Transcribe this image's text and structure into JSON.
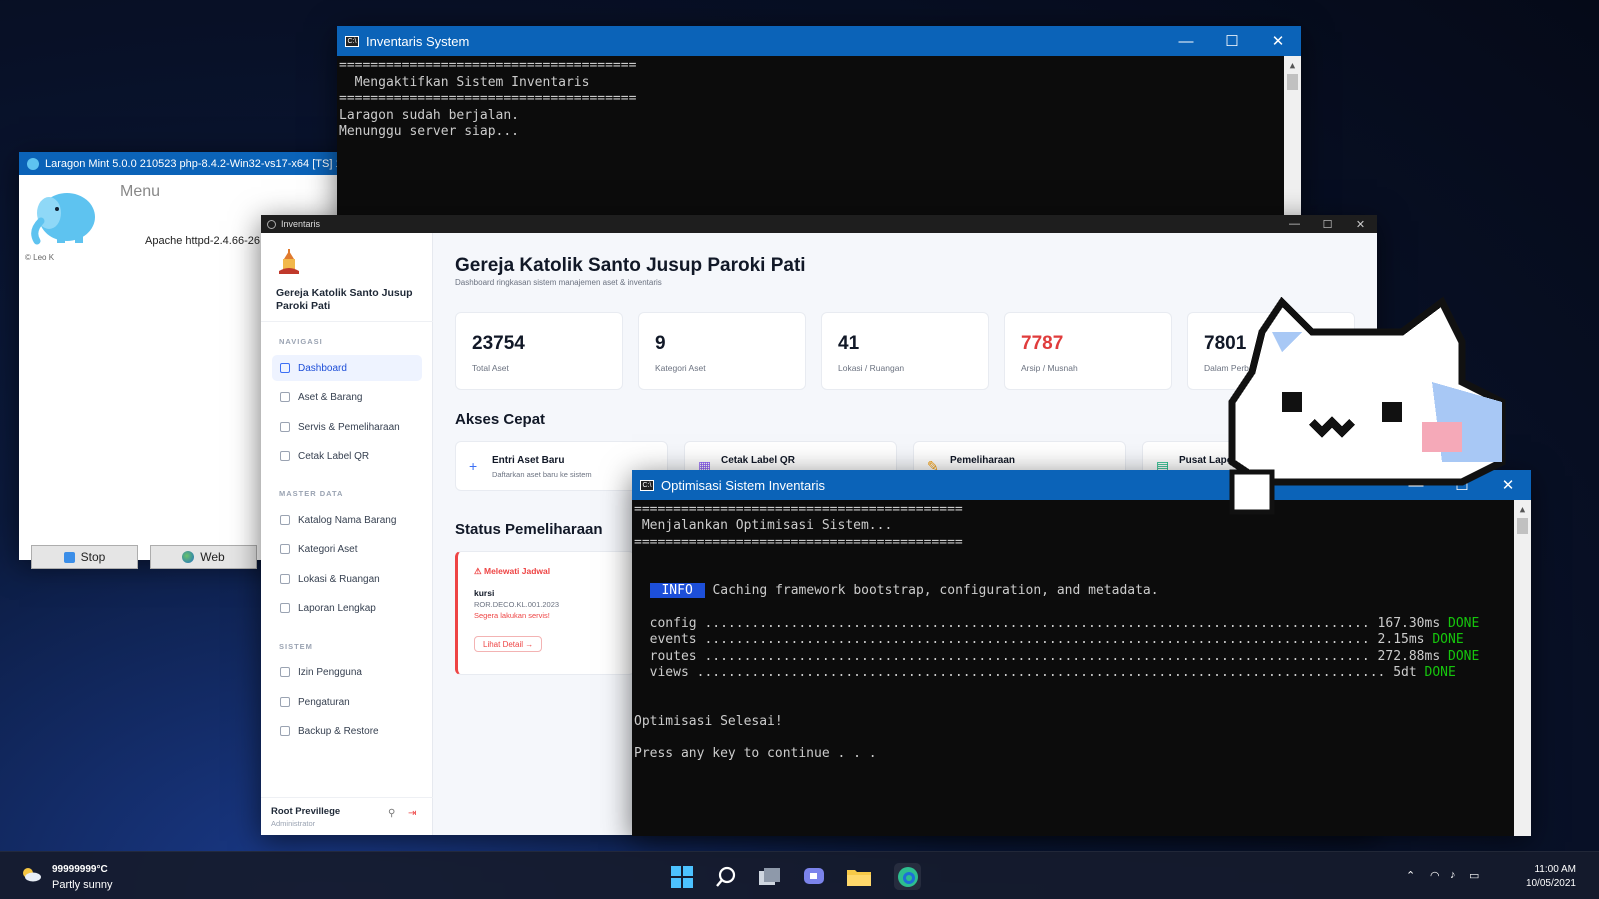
{
  "colors": {
    "accent": "#0b63b8",
    "done": "#16c60c",
    "danger": "#e03c3c",
    "primary": "#1d4ed8"
  },
  "laragon": {
    "title": "Laragon Mint 5.0.0 210523 php-8.4.2-Win32-vs17-x64 [TS]  192.168.112.1",
    "menu_label": "Menu",
    "version_label": "© Leo K",
    "apache_label": "Apache httpd-2.4.66-26",
    "stop_label": "Stop",
    "web_label": "Web",
    "icons": [
      "h",
      "?",
      "gear-icon"
    ]
  },
  "invsys": {
    "title": "Inventaris System",
    "lines": [
      "======================================",
      "  Mengaktifkan Sistem Inventaris",
      "======================================",
      "Laragon sudah berjalan.",
      "Menunggu server siap..."
    ]
  },
  "app": {
    "title": "Inventaris",
    "sidebar": {
      "church_name": "Gereja Katolik Santo Jusup Paroki Pati",
      "section_nav": "NAVIGASI",
      "section_master": "MASTER DATA",
      "section_system": "SISTEM",
      "nav": [
        "Dashboard",
        "Aset & Barang",
        "Servis & Pemeliharaan",
        "Cetak Label QR"
      ],
      "master": [
        "Katalog Nama Barang",
        "Kategori Aset",
        "Lokasi & Ruangan",
        "Laporan Lengkap"
      ],
      "system": [
        "Izin Pengguna",
        "Pengaturan",
        "Backup & Restore"
      ],
      "user_name": "Root Previllege",
      "user_role": "Administrator"
    },
    "main": {
      "title": "Gereja Katolik Santo Jusup Paroki Pati",
      "subtitle": "Dashboard ringkasan sistem manajemen aset & inventaris",
      "stats": [
        {
          "value": "23754",
          "label": "Total Aset"
        },
        {
          "value": "9",
          "label": "Kategori Aset"
        },
        {
          "value": "41",
          "label": "Lokasi / Ruangan"
        },
        {
          "value": "7787",
          "label": "Arsip / Musnah"
        },
        {
          "value": "7801",
          "label": "Dalam Perba"
        }
      ],
      "quick_title": "Akses Cepat",
      "quick": [
        {
          "title": "Entri Aset Baru",
          "sub": "Daftarkan aset baru ke sistem",
          "icon": "+"
        },
        {
          "title": "Cetak Label QR",
          "sub": "",
          "icon": "▦"
        },
        {
          "title": "Pemeliharaan",
          "sub": "",
          "icon": "✎"
        },
        {
          "title": "Pusat Lapo",
          "sub": "",
          "icon": "▤"
        }
      ],
      "maint_title": "Status Pemeliharaan",
      "maint_card": {
        "header": "Melewati Jadwal",
        "item": "kursi",
        "code": "ROR.DECO.KL.001.2023",
        "note": "Segera lakukan servis!",
        "button": "Lihat Detail →"
      }
    }
  },
  "optim": {
    "title": "Optimisasi Sistem Inventaris",
    "sep": "==========================================",
    "heading": " Menjalankan Optimisasi Sistem...",
    "info_badge": " INFO ",
    "info_text": " Caching framework bootstrap, configuration, and metadata.",
    "tasks": [
      {
        "dots": "  config ..................................................................................... ",
        "time": "167.30ms",
        "status": " DONE"
      },
      {
        "dots": "  events ..................................................................................... ",
        "time": "2.15ms",
        "status": " DONE"
      },
      {
        "dots": "  routes ..................................................................................... ",
        "time": "272.88ms",
        "status": " DONE"
      },
      {
        "dots": "  views ........................................................................................ ",
        "time": "5dt",
        "status": " DONE"
      }
    ],
    "done_text": "Optimisasi Selesai!",
    "press_text": "Press any key to continue . . ."
  },
  "taskbar": {
    "temp": "99999999°C",
    "weather": "Partly sunny",
    "time": "11:00 AM",
    "date": "10/05/2021"
  }
}
